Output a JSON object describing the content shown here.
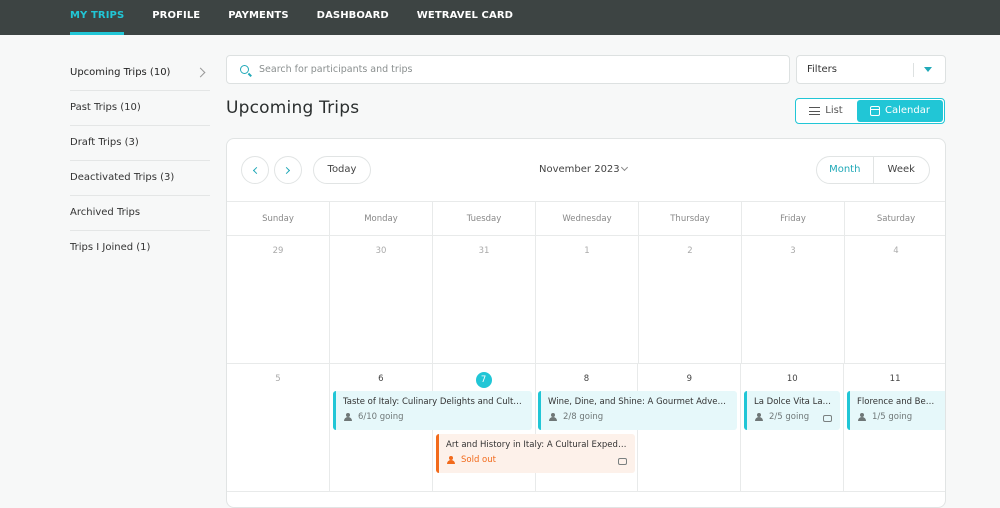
{
  "topnav": {
    "items": [
      {
        "label": "MY TRIPS",
        "active": true
      },
      {
        "label": "PROFILE"
      },
      {
        "label": "PAYMENTS"
      },
      {
        "label": "DASHBOARD"
      },
      {
        "label": "WETRAVEL CARD"
      }
    ]
  },
  "sidebar": {
    "items": [
      {
        "label": "Upcoming Trips (10)",
        "active": true
      },
      {
        "label": "Past Trips (10)"
      },
      {
        "label": "Draft Trips (3)"
      },
      {
        "label": "Deactivated Trips (3)"
      },
      {
        "label": "Archived Trips"
      },
      {
        "label": "Trips I Joined (1)"
      }
    ]
  },
  "search": {
    "placeholder": "Search for participants and trips",
    "value": ""
  },
  "filters": {
    "label": "Filters"
  },
  "page_title": "Upcoming Trips",
  "view_toggle": {
    "list": "List",
    "calendar": "Calendar",
    "active": "calendar"
  },
  "calendar": {
    "today_label": "Today",
    "month_label": "November 2023",
    "modes": {
      "month": "Month",
      "week": "Week",
      "active": "month"
    },
    "weekdays": [
      "Sunday",
      "Monday",
      "Tuesday",
      "Wednesday",
      "Thursday",
      "Friday",
      "Saturday"
    ],
    "weeks": [
      [
        "29",
        "30",
        "31",
        "1",
        "2",
        "3",
        "4"
      ],
      [
        "5",
        "6",
        "7",
        "8",
        "9",
        "10",
        "11"
      ]
    ],
    "today": "7",
    "events": [
      {
        "title": "Taste of Italy: Culinary Delights and Cultural Treasures",
        "status": "6/10 going"
      },
      {
        "title": "Wine, Dine, and Shine: A Gourmet Adventure in Italy",
        "status": "2/8 going"
      },
      {
        "title": "La Dolce Vita La Dolce Vita",
        "status": "2/5 going"
      },
      {
        "title": "Florence and Beyond",
        "status": "1/5 going"
      },
      {
        "title": "Art and History in Italy: A Cultural Expedition",
        "status": "Sold out"
      }
    ]
  },
  "colors": {
    "accent": "#21c6d6",
    "topbar": "#3d4443",
    "sold_out": "#f26a1b"
  }
}
